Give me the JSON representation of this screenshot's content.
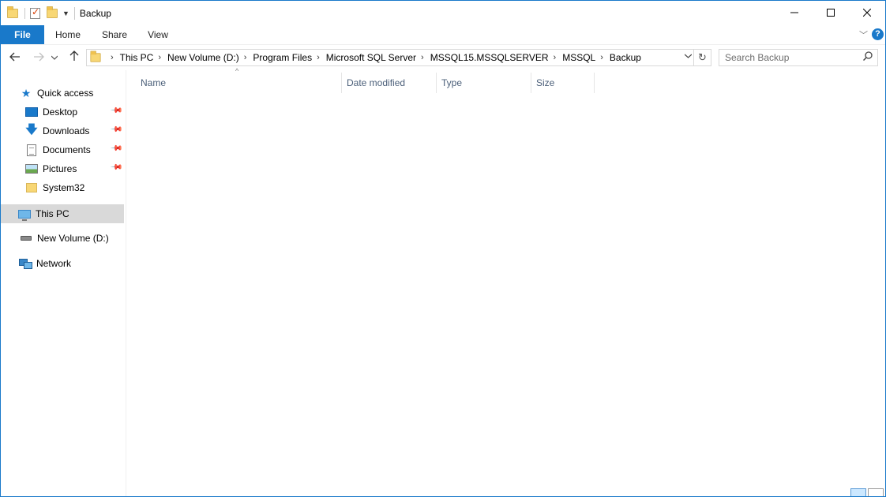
{
  "window": {
    "title": "Backup"
  },
  "ribbon": {
    "tabs": [
      "File",
      "Home",
      "Share",
      "View"
    ],
    "help_label": "?"
  },
  "window_controls": {
    "minimize": "—",
    "maximize": "☐",
    "close": "✕"
  },
  "address_bar": {
    "breadcrumbs": [
      "This PC",
      "New Volume (D:)",
      "Program Files",
      "Microsoft SQL Server",
      "MSSQL15.MSSQLSERVER",
      "MSSQL",
      "Backup"
    ]
  },
  "search": {
    "placeholder": "Search Backup",
    "value": ""
  },
  "nav_pane": {
    "quick_access": "Quick access",
    "items": [
      {
        "label": "Desktop",
        "icon": "desktop-icon",
        "pinned": true
      },
      {
        "label": "Downloads",
        "icon": "downloads-icon",
        "pinned": true
      },
      {
        "label": "Documents",
        "icon": "documents-icon",
        "pinned": true
      },
      {
        "label": "Pictures",
        "icon": "pictures-icon",
        "pinned": true
      },
      {
        "label": "System32",
        "icon": "folder-icon",
        "pinned": false
      }
    ],
    "this_pc": "This PC",
    "drive": "New Volume (D:)",
    "network": "Network"
  },
  "file_list": {
    "columns": [
      "Name",
      "Date modified",
      "Type",
      "Size"
    ],
    "sorted_column": "Name",
    "rows": []
  },
  "colors": {
    "accent": "#1979ca",
    "selected_nav": "#d9d9d9",
    "column_header_text": "#4c607a"
  }
}
